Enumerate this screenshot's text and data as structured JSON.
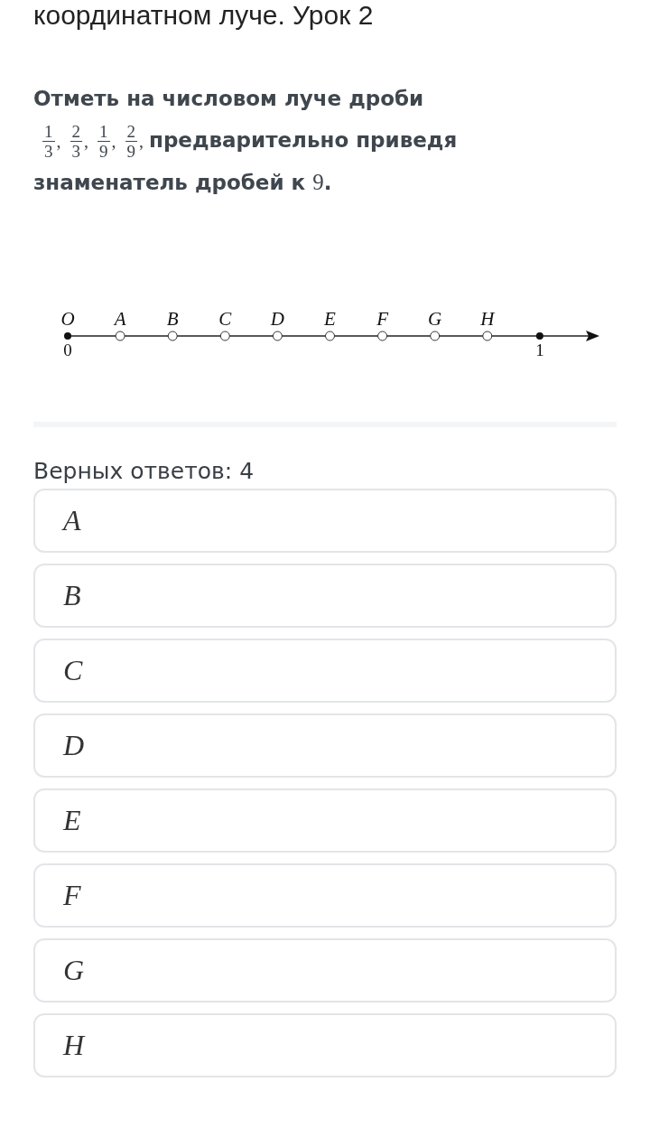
{
  "title": "координатном луче. Урок 2",
  "question": {
    "intro": "Отметь на числовом луче дроби",
    "fractions": [
      {
        "num": "1",
        "den": "3",
        "sep": ","
      },
      {
        "num": "2",
        "den": "3",
        "sep": ","
      },
      {
        "num": "1",
        "den": "9",
        "sep": ","
      },
      {
        "num": "2",
        "den": "9",
        "sep": ","
      }
    ],
    "tail_first": "предварительно приведя",
    "tail": "знаменатель дробей к",
    "tail_number": "9",
    "tail_end": "."
  },
  "number_line": {
    "origin": "O",
    "origin_value": "0",
    "end_value": "1",
    "points": [
      "A",
      "B",
      "C",
      "D",
      "E",
      "F",
      "G",
      "H"
    ]
  },
  "correct_count": "Верных ответов: 4",
  "options": [
    "A",
    "B",
    "C",
    "D",
    "E",
    "F",
    "G",
    "H"
  ]
}
